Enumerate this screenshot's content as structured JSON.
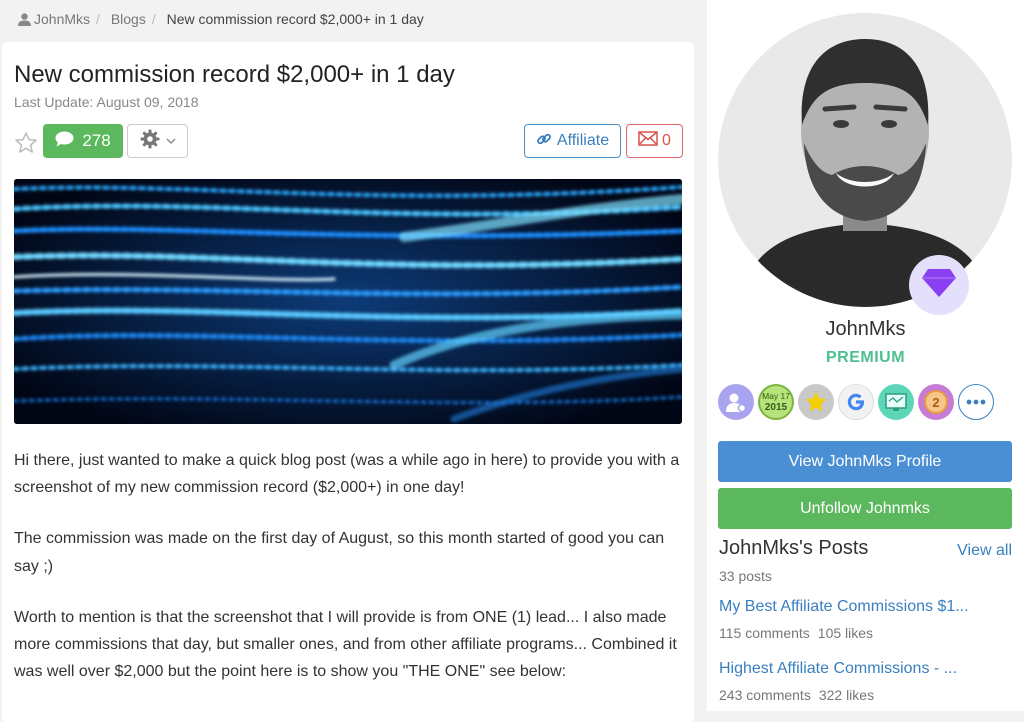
{
  "breadcrumb": {
    "user": "JohnMks",
    "section": "Blogs",
    "current": "New commission record $2,000+ in 1 day"
  },
  "article": {
    "title": "New commission record $2,000+ in 1 day",
    "last_update": "Last Update: August 09, 2018",
    "comments_count": "278",
    "affiliate_label": "Affiliate",
    "mail_count": "0",
    "paragraphs": [
      "Hi there, just wanted to make a quick blog post (was a while ago in here) to provide you with a screenshot of my new commission record ($2,000+) in one day!",
      "The commission was made on the first day of August, so this month started of good you can say ;)",
      "Worth to mention is that the screenshot that I will provide is from ONE (1) lead... I also made more commissions that day, but smaller ones, and from other affiliate programs... Combined it was well over $2,000 but the point here is to show you \"THE ONE\" see below:"
    ]
  },
  "profile": {
    "name": "JohnMks",
    "rank": "PREMIUM",
    "badges": [
      {
        "icon": "user-gear-icon",
        "color": "#a9a4f0"
      },
      {
        "icon": "date-badge-icon",
        "text": "May 17 2015",
        "color": "#b8e27a"
      },
      {
        "icon": "star-icon",
        "color": "#f5d000"
      },
      {
        "icon": "google-icon",
        "color": "#f4f4f4"
      },
      {
        "icon": "screen-icon",
        "color": "#5dd6b8"
      },
      {
        "icon": "medal-2-icon",
        "text": "2",
        "color": "#e8c0f0"
      },
      {
        "icon": "more-icon",
        "color": "#3a7fbf"
      }
    ],
    "view_profile_label": "View JohnMks Profile",
    "unfollow_label": "Unfollow Johnmks"
  },
  "posts": {
    "heading": "JohnMks's Posts",
    "view_all": "View all",
    "count": "33 posts",
    "items": [
      {
        "title": "My Best Affiliate Commissions $1...",
        "comments": "115 comments",
        "likes": "105 likes"
      },
      {
        "title": "Highest Affiliate Commissions - ...",
        "comments": "243 comments",
        "likes": "322 likes"
      }
    ]
  },
  "colors": {
    "green": "#5cb85c",
    "blue": "#4a8fd4",
    "link": "#3a7fbf",
    "red": "#d9534f",
    "premium": "#4cc08f",
    "diamond": "#8a3ff0"
  }
}
